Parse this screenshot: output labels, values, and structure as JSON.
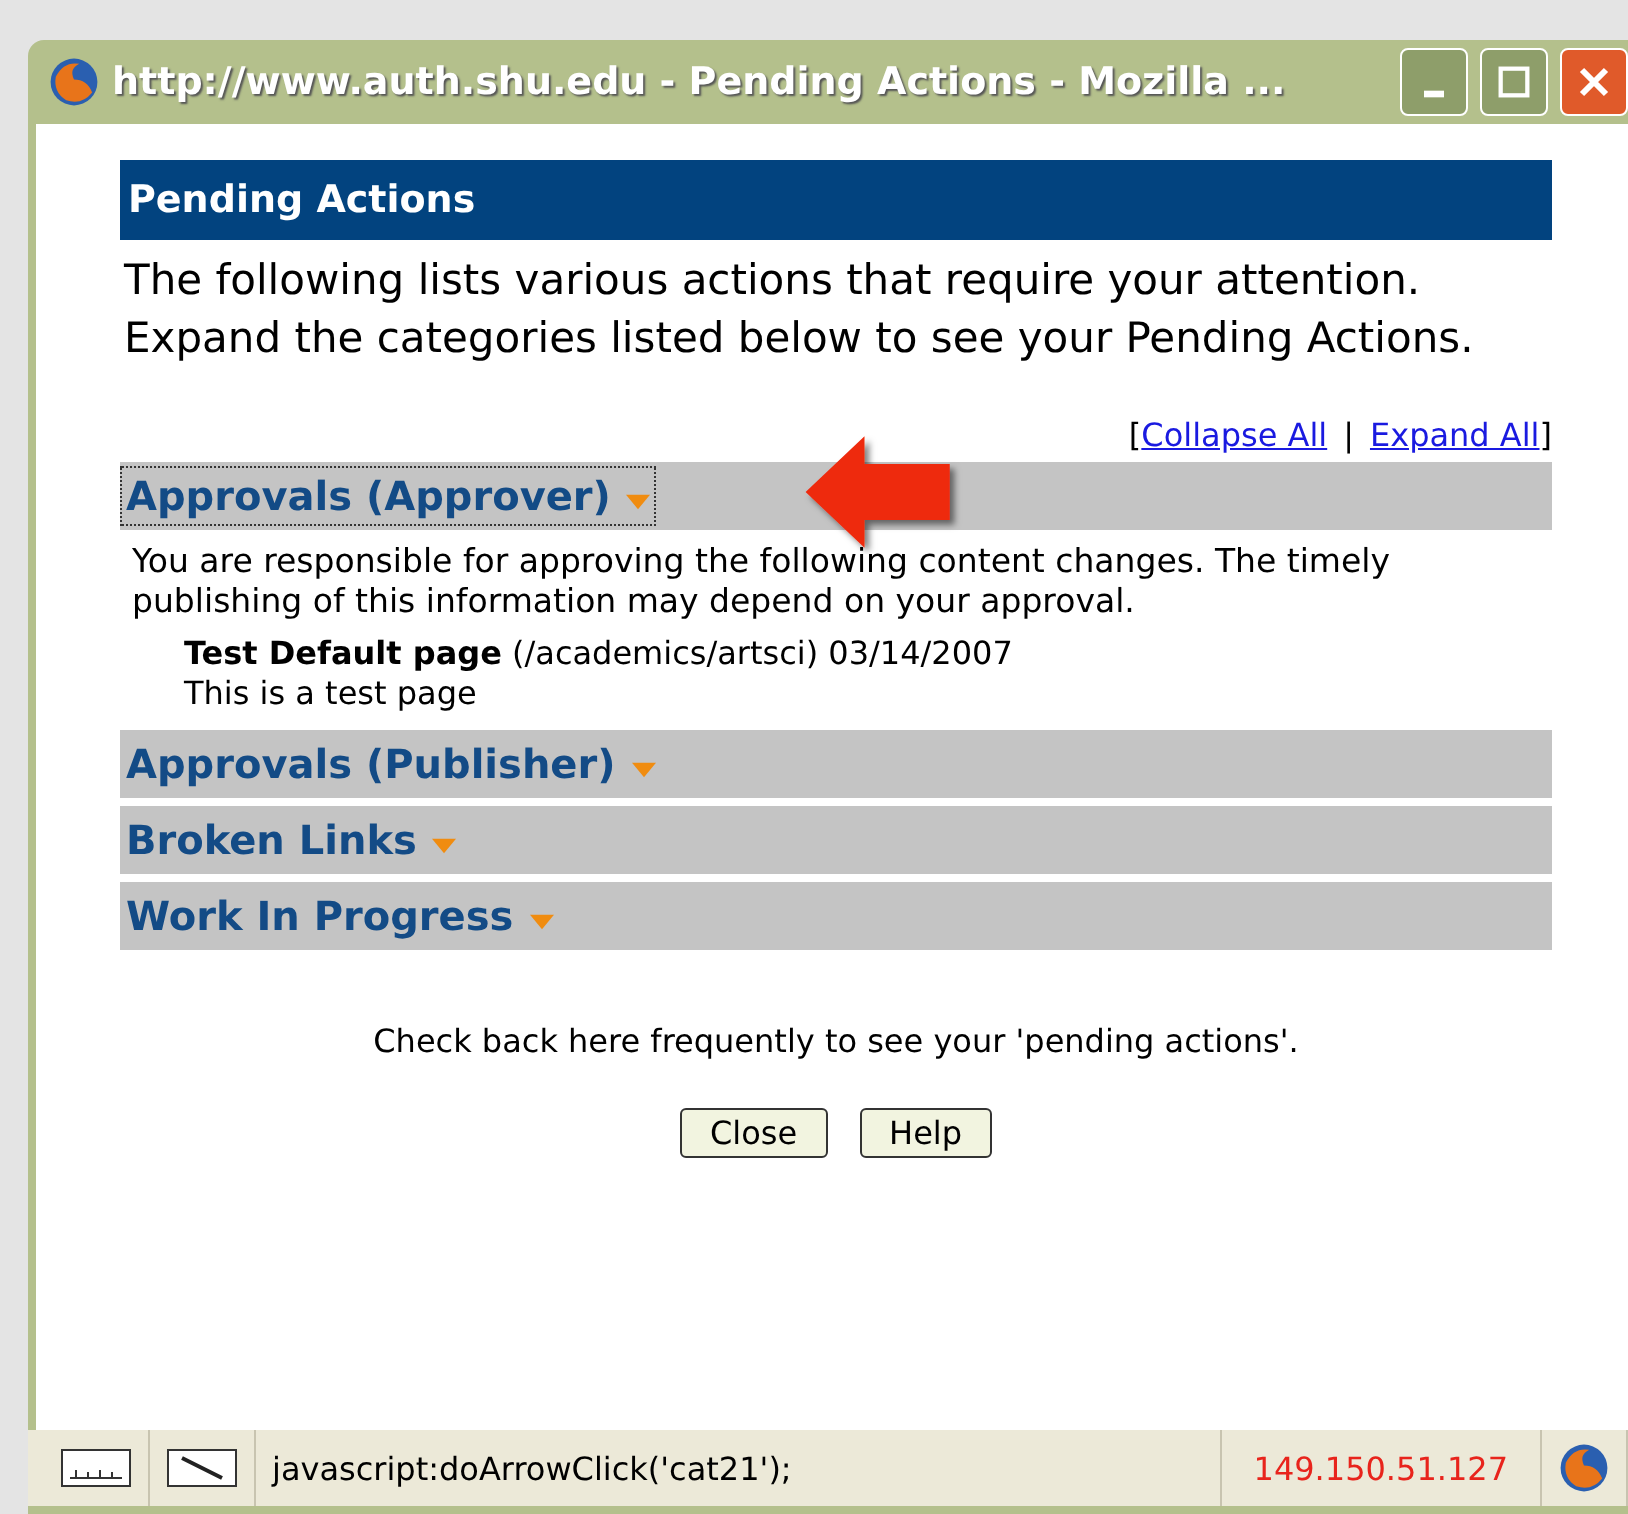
{
  "window": {
    "title": "http://www.auth.shu.edu - Pending Actions - Mozilla ..."
  },
  "panel": {
    "title": "Pending Actions",
    "intro": "The following lists various actions that require your attention. Expand the categories listed below to see your Pending Actions."
  },
  "links": {
    "open": "[",
    "collapse": "Collapse All",
    "separator": "|",
    "expand": "Expand All",
    "close": "]"
  },
  "categories": [
    {
      "title": "Approvals (Approver)",
      "focused": true,
      "description": "You are responsible for approving the following content changes. The timely publishing of this information may depend on your approval.",
      "items": [
        {
          "name": "Test Default page",
          "path": "(/academics/artsci) 03/14/2007",
          "note": "This is a test page"
        }
      ]
    },
    {
      "title": "Approvals (Publisher)",
      "focused": false
    },
    {
      "title": "Broken Links",
      "focused": false
    },
    {
      "title": "Work In Progress",
      "focused": false
    }
  ],
  "footer": "Check back here frequently to see your 'pending actions'.",
  "buttons": [
    "Close",
    "Help"
  ],
  "status_bar": {
    "message": "javascript:doArrowClick('cat21');",
    "ip": "149.150.51.127"
  }
}
